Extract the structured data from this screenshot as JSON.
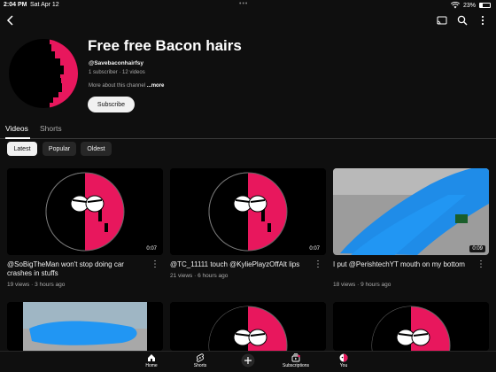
{
  "status_bar": {
    "time": "2:04 PM",
    "date": "Sat Apr 12",
    "dots": "•••",
    "battery_text": "23%",
    "battery_level": 0.23
  },
  "top_bar": {
    "icons": [
      "back-arrow-icon",
      "cast-icon",
      "search-icon",
      "more-vertical-icon"
    ]
  },
  "channel": {
    "title": "Free free Bacon hairs",
    "handle": "@Savebaconhairfsy",
    "meta": "1 subscriber · 12 videos",
    "about": "More about this channel",
    "more": "...more",
    "subscribe_label": "Subscribe",
    "colors": {
      "left": "#000000",
      "right": "#e8175d"
    }
  },
  "tabs": [
    {
      "label": "Videos",
      "active": true
    },
    {
      "label": "Shorts",
      "active": false
    }
  ],
  "filters": [
    {
      "label": "Latest",
      "selected": true
    },
    {
      "label": "Popular",
      "selected": false
    },
    {
      "label": "Oldest",
      "selected": false
    }
  ],
  "videos": [
    {
      "title": "@SoBigTheMan won't stop doing car crashes in stuffs",
      "meta": "19 views · 3 hours ago",
      "duration": "0:07"
    },
    {
      "title": "@TC_11111 touch @KyliePlayzOffAlt lips",
      "meta": "21 views · 6 hours ago",
      "duration": "0:07"
    },
    {
      "title": "I put @PerishtechYT mouth on my bottom",
      "meta": "18 views · 9 hours ago",
      "duration": "0:09"
    }
  ],
  "bottom_nav": [
    {
      "label": "Home",
      "icon": "home-icon"
    },
    {
      "label": "Shorts",
      "icon": "shorts-icon"
    },
    {
      "label": "",
      "icon": "create-plus-icon"
    },
    {
      "label": "Subscriptions",
      "icon": "subscriptions-icon"
    },
    {
      "label": "You",
      "icon": "you-avatar-icon"
    }
  ]
}
